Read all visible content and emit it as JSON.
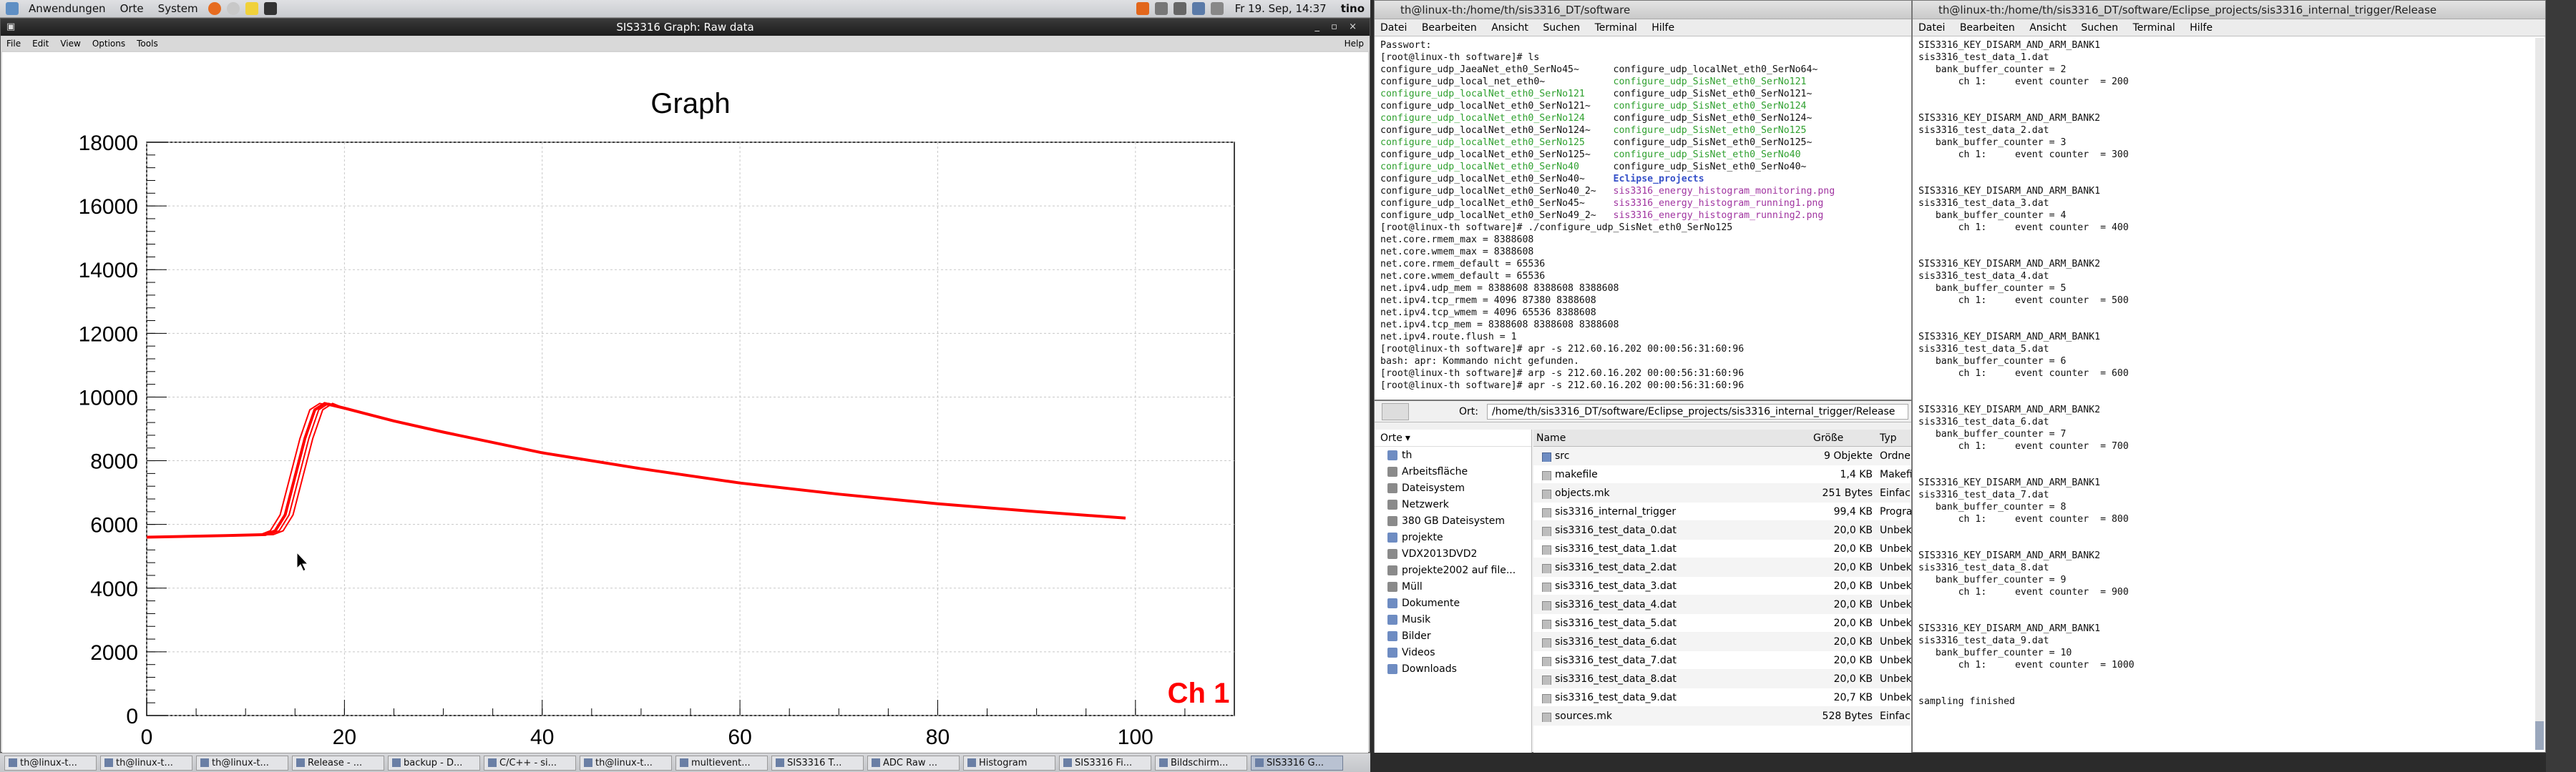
{
  "top_panel": {
    "menus": [
      "Anwendungen",
      "Orte",
      "System"
    ],
    "clock": "Fr 19. Sep, 14:37",
    "user": "tino"
  },
  "graph_window": {
    "title": "SIS3316 Graph: Raw data",
    "menu": [
      "File",
      "Edit",
      "View",
      "Options",
      "Tools"
    ],
    "help": "Help",
    "controls": "_ ▫ ×",
    "plot_title": "Graph",
    "channel_label": "Ch 1",
    "channel_color": "#ff0000",
    "trace_color": "#ff0000"
  },
  "chart_data": {
    "type": "line",
    "title": "Graph",
    "xlabel": "",
    "ylabel": "",
    "xlim": [
      0,
      110
    ],
    "ylim": [
      0,
      18000
    ],
    "xticks": [
      0,
      20,
      40,
      60,
      80,
      100
    ],
    "yticks": [
      0,
      2000,
      4000,
      6000,
      8000,
      10000,
      12000,
      14000,
      16000,
      18000
    ],
    "grid": true,
    "series": [
      {
        "x": [
          0,
          8,
          12,
          13,
          14,
          15,
          16,
          17,
          18,
          20,
          25,
          30,
          40,
          50,
          60,
          70,
          80,
          90,
          99
        ],
        "values": [
          5600,
          5650,
          5680,
          5800,
          6300,
          7500,
          8700,
          9600,
          9800,
          9650,
          9250,
          8900,
          8250,
          7750,
          7300,
          6950,
          6650,
          6400,
          6200
        ]
      }
    ]
  },
  "terminal1": {
    "title": "th@linux-th:/home/th/sis3316_DT/software",
    "menu": [
      "Datei",
      "Bearbeiten",
      "Ansicht",
      "Suchen",
      "Terminal",
      "Hilfe"
    ],
    "lines": [
      {
        "segs": [
          {
            "t": "Passwort:",
            "c": ""
          }
        ]
      },
      {
        "segs": [
          {
            "t": "[root@linux-th software]# ls",
            "c": ""
          }
        ]
      },
      {
        "segs": [
          {
            "t": "configure_udp_JaeaNet_eth0_SerNo45~      ",
            "c": ""
          },
          {
            "t": "configure_udp_localNet_eth0_SerNo64~",
            "c": ""
          }
        ]
      },
      {
        "segs": [
          {
            "t": "configure_udp_local_net_eth0~            ",
            "c": ""
          },
          {
            "t": "configure_udp_SisNet_eth0_SerNo121",
            "c": "green"
          }
        ]
      },
      {
        "segs": [
          {
            "t": "configure_udp_localNet_eth0_SerNo121     ",
            "c": "green"
          },
          {
            "t": "configure_udp_SisNet_eth0_SerNo121~",
            "c": ""
          }
        ]
      },
      {
        "segs": [
          {
            "t": "configure_udp_localNet_eth0_SerNo121~    ",
            "c": ""
          },
          {
            "t": "configure_udp_SisNet_eth0_SerNo124",
            "c": "green"
          }
        ]
      },
      {
        "segs": [
          {
            "t": "configure_udp_localNet_eth0_SerNo124     ",
            "c": "green"
          },
          {
            "t": "configure_udp_SisNet_eth0_SerNo124~",
            "c": ""
          }
        ]
      },
      {
        "segs": [
          {
            "t": "configure_udp_localNet_eth0_SerNo124~    ",
            "c": ""
          },
          {
            "t": "configure_udp_SisNet_eth0_SerNo125",
            "c": "green"
          }
        ]
      },
      {
        "segs": [
          {
            "t": "configure_udp_localNet_eth0_SerNo125     ",
            "c": "green"
          },
          {
            "t": "configure_udp_SisNet_eth0_SerNo125~",
            "c": ""
          }
        ]
      },
      {
        "segs": [
          {
            "t": "configure_udp_localNet_eth0_SerNo125~    ",
            "c": ""
          },
          {
            "t": "configure_udp_SisNet_eth0_SerNo40",
            "c": "green"
          }
        ]
      },
      {
        "segs": [
          {
            "t": "configure_udp_localNet_eth0_SerNo40      ",
            "c": "green"
          },
          {
            "t": "configure_udp_SisNet_eth0_SerNo40~",
            "c": ""
          }
        ]
      },
      {
        "segs": [
          {
            "t": "configure_udp_localNet_eth0_SerNo40~     ",
            "c": ""
          },
          {
            "t": "Eclipse_projects",
            "c": "blue"
          }
        ]
      },
      {
        "segs": [
          {
            "t": "configure_udp_localNet_eth0_SerNo40_2~   ",
            "c": ""
          },
          {
            "t": "sis3316_energy_histogram_monitoring.png",
            "c": "mag"
          }
        ]
      },
      {
        "segs": [
          {
            "t": "configure_udp_localNet_eth0_SerNo45~     ",
            "c": ""
          },
          {
            "t": "sis3316_energy_histogram_running1.png",
            "c": "mag"
          }
        ]
      },
      {
        "segs": [
          {
            "t": "configure_udp_localNet_eth0_SerNo49_2~   ",
            "c": ""
          },
          {
            "t": "sis3316_energy_histogram_running2.png",
            "c": "mag"
          }
        ]
      },
      {
        "segs": [
          {
            "t": "[root@linux-th software]# ./configure_udp_SisNet_eth0_SerNo125",
            "c": ""
          }
        ]
      },
      {
        "segs": [
          {
            "t": "net.core.rmem_max = 8388608",
            "c": ""
          }
        ]
      },
      {
        "segs": [
          {
            "t": "net.core.wmem_max = 8388608",
            "c": ""
          }
        ]
      },
      {
        "segs": [
          {
            "t": "net.core.rmem_default = 65536",
            "c": ""
          }
        ]
      },
      {
        "segs": [
          {
            "t": "net.core.wmem_default = 65536",
            "c": ""
          }
        ]
      },
      {
        "segs": [
          {
            "t": "net.ipv4.udp_mem = 8388608 8388608 8388608",
            "c": ""
          }
        ]
      },
      {
        "segs": [
          {
            "t": "net.ipv4.tcp_rmem = 4096 87380 8388608",
            "c": ""
          }
        ]
      },
      {
        "segs": [
          {
            "t": "net.ipv4.tcp_wmem = 4096 65536 8388608",
            "c": ""
          }
        ]
      },
      {
        "segs": [
          {
            "t": "net.ipv4.tcp_mem = 8388608 8388608 8388608",
            "c": ""
          }
        ]
      },
      {
        "segs": [
          {
            "t": "net.ipv4.route.flush = 1",
            "c": ""
          }
        ]
      },
      {
        "segs": [
          {
            "t": "[root@linux-th software]# apr -s 212.60.16.202 00:00:56:31:60:96",
            "c": ""
          }
        ]
      },
      {
        "segs": [
          {
            "t": "bash: apr: Kommando nicht gefunden.",
            "c": ""
          }
        ]
      },
      {
        "segs": [
          {
            "t": "[root@linux-th software]# arp -s 212.60.16.202 00:00:56:31:60:96",
            "c": ""
          }
        ]
      },
      {
        "segs": [
          {
            "t": "[root@linux-th software]# apr -s 212.60.16.202 00:00:56:31:60:96",
            "c": ""
          }
        ]
      }
    ]
  },
  "file_manager": {
    "location_label": "Ort:",
    "location": "/home/th/sis3316_DT/software/Eclipse_projects/sis3316_internal_trigger/Release",
    "places_label": "Orte",
    "places": [
      {
        "label": "th",
        "icon": "home-folder-icon"
      },
      {
        "label": "Arbeitsfläche",
        "icon": "desktop-icon"
      },
      {
        "label": "Dateisystem",
        "icon": "drive-icon"
      },
      {
        "label": "Netzwerk",
        "icon": "network-icon"
      },
      {
        "label": "380 GB Dateisystem",
        "icon": "drive-icon"
      },
      {
        "label": "projekte",
        "icon": "folder-icon"
      },
      {
        "label": "VDX2013DVD2",
        "icon": "disc-icon"
      },
      {
        "label": "projekte2002 auf file...",
        "icon": "network-share-icon"
      },
      {
        "label": "Müll",
        "icon": "trash-icon"
      },
      {
        "label": "Dokumente",
        "icon": "folder-icon"
      },
      {
        "label": "Musik",
        "icon": "folder-icon"
      },
      {
        "label": "Bilder",
        "icon": "folder-icon"
      },
      {
        "label": "Videos",
        "icon": "folder-icon"
      },
      {
        "label": "Downloads",
        "icon": "folder-icon"
      }
    ],
    "columns": [
      "Name",
      "Größe",
      "Typ"
    ],
    "files": [
      {
        "name": "src",
        "size": "9 Objekte",
        "type": "Ordner",
        "dir": true
      },
      {
        "name": "makefile",
        "size": "1,4 KB",
        "type": "Makefile"
      },
      {
        "name": "objects.mk",
        "size": "251 Bytes",
        "type": "Einfache"
      },
      {
        "name": "sis3316_internal_trigger",
        "size": "99,4 KB",
        "type": "Program"
      },
      {
        "name": "sis3316_test_data_0.dat",
        "size": "20,0 KB",
        "type": "Unbekan"
      },
      {
        "name": "sis3316_test_data_1.dat",
        "size": "20,0 KB",
        "type": "Unbekan"
      },
      {
        "name": "sis3316_test_data_2.dat",
        "size": "20,0 KB",
        "type": "Unbekan"
      },
      {
        "name": "sis3316_test_data_3.dat",
        "size": "20,0 KB",
        "type": "Unbekan"
      },
      {
        "name": "sis3316_test_data_4.dat",
        "size": "20,0 KB",
        "type": "Unbekan"
      },
      {
        "name": "sis3316_test_data_5.dat",
        "size": "20,0 KB",
        "type": "Unbekan"
      },
      {
        "name": "sis3316_test_data_6.dat",
        "size": "20,0 KB",
        "type": "Unbekan"
      },
      {
        "name": "sis3316_test_data_7.dat",
        "size": "20,0 KB",
        "type": "Unbekan"
      },
      {
        "name": "sis3316_test_data_8.dat",
        "size": "20,0 KB",
        "type": "Unbekan"
      },
      {
        "name": "sis3316_test_data_9.dat",
        "size": "20,7 KB",
        "type": "Unbekan"
      },
      {
        "name": "sources.mk",
        "size": "528 Bytes",
        "type": "Einfache"
      }
    ]
  },
  "terminal2": {
    "title": "th@linux-th:/home/th/sis3316_DT/software/Eclipse_projects/sis3316_internal_trigger/Release",
    "menu": [
      "Datei",
      "Bearbeiten",
      "Ansicht",
      "Suchen",
      "Terminal",
      "Hilfe"
    ],
    "text": "SIS3316_KEY_DISARM_AND_ARM_BANK1\nsis3316_test_data_1.dat\n   bank_buffer_counter = 2\n       ch 1:     event counter  = 200\n\n\nSIS3316_KEY_DISARM_AND_ARM_BANK2\nsis3316_test_data_2.dat\n   bank_buffer_counter = 3\n       ch 1:     event counter  = 300\n\n\nSIS3316_KEY_DISARM_AND_ARM_BANK1\nsis3316_test_data_3.dat\n   bank_buffer_counter = 4\n       ch 1:     event counter  = 400\n\n\nSIS3316_KEY_DISARM_AND_ARM_BANK2\nsis3316_test_data_4.dat\n   bank_buffer_counter = 5\n       ch 1:     event counter  = 500\n\n\nSIS3316_KEY_DISARM_AND_ARM_BANK1\nsis3316_test_data_5.dat\n   bank_buffer_counter = 6\n       ch 1:     event counter  = 600\n\n\nSIS3316_KEY_DISARM_AND_ARM_BANK2\nsis3316_test_data_6.dat\n   bank_buffer_counter = 7\n       ch 1:     event counter  = 700\n\n\nSIS3316_KEY_DISARM_AND_ARM_BANK1\nsis3316_test_data_7.dat\n   bank_buffer_counter = 8\n       ch 1:     event counter  = 800\n\n\nSIS3316_KEY_DISARM_AND_ARM_BANK2\nsis3316_test_data_8.dat\n   bank_buffer_counter = 9\n       ch 1:     event counter  = 900\n\n\nSIS3316_KEY_DISARM_AND_ARM_BANK1\nsis3316_test_data_9.dat\n   bank_buffer_counter = 10\n       ch 1:     event counter  = 1000\n\n\nsampling finished"
  },
  "taskbar": [
    {
      "label": "th@linux-t..."
    },
    {
      "label": "th@linux-t..."
    },
    {
      "label": "th@linux-t..."
    },
    {
      "label": "Release - ..."
    },
    {
      "label": "backup - D..."
    },
    {
      "label": "C/C++ - si..."
    },
    {
      "label": "th@linux-t..."
    },
    {
      "label": "multievent..."
    },
    {
      "label": "SIS3316 T..."
    },
    {
      "label": "ADC Raw ..."
    },
    {
      "label": "Histogram"
    },
    {
      "label": "SIS3316 Fi..."
    },
    {
      "label": "Bildschirm..."
    },
    {
      "label": "SIS3316 G...",
      "active": true
    }
  ]
}
